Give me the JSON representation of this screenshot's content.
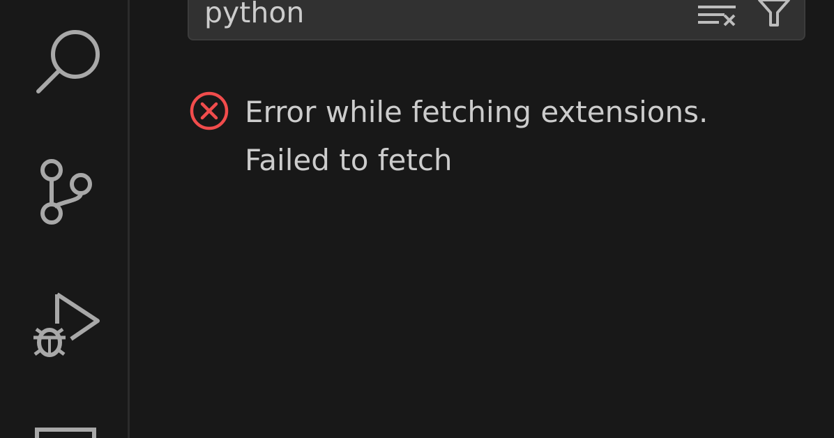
{
  "search": {
    "value": "python",
    "actions": [
      {
        "icon": "clear-filter-icon"
      },
      {
        "icon": "filter-icon"
      }
    ]
  },
  "activity_bar": {
    "items": [
      {
        "icon": "search-icon"
      },
      {
        "icon": "source-control-icon"
      },
      {
        "icon": "run-debug-icon"
      },
      {
        "icon": "panel-icon"
      }
    ]
  },
  "message": {
    "icon": "error-icon",
    "line1": "Error while fetching extensions.",
    "line2": "Failed to fetch"
  },
  "colors": {
    "background": "#181818",
    "input_background": "#313131",
    "text": "#cccccc",
    "icon": "#a8a8a8",
    "error": "#f14c4c"
  }
}
